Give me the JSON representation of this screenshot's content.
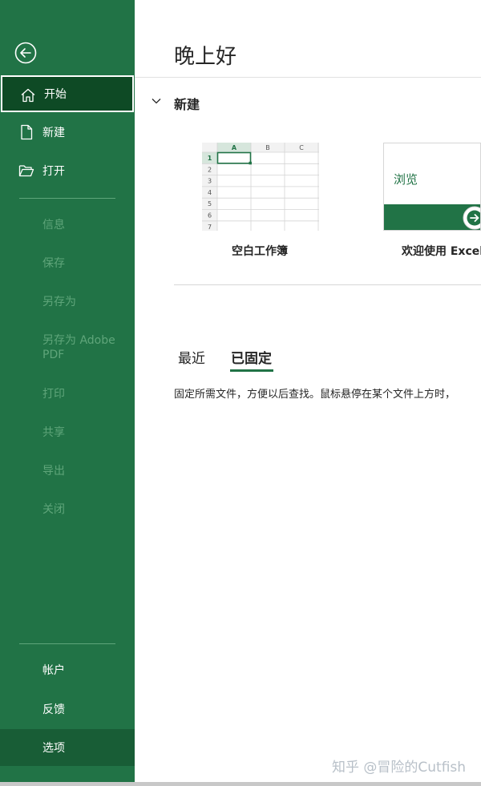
{
  "sidebar": {
    "back_icon": "back-arrow-icon",
    "items": [
      {
        "label": "开始",
        "icon": "home-icon"
      },
      {
        "label": "新建",
        "icon": "new-file-icon"
      },
      {
        "label": "打开",
        "icon": "open-folder-icon"
      }
    ],
    "disabled_items": [
      {
        "label": "信息"
      },
      {
        "label": "保存"
      },
      {
        "label": "另存为"
      },
      {
        "label": "另存为 Adobe PDF"
      },
      {
        "label": "打印"
      },
      {
        "label": "共享"
      },
      {
        "label": "导出"
      },
      {
        "label": "关闭"
      }
    ],
    "bottom_items": [
      {
        "label": "帐户"
      },
      {
        "label": "反馈"
      },
      {
        "label": "选项"
      }
    ]
  },
  "main": {
    "greeting": "晚上好",
    "new_section": {
      "title": "新建",
      "templates": [
        {
          "label": "空白工作簿",
          "thumb_columns": [
            "A",
            "B",
            "C"
          ],
          "thumb_rows": [
            "1",
            "2",
            "3",
            "4",
            "5",
            "6",
            "7"
          ]
        },
        {
          "label": "欢迎使用 Excel",
          "thumb_text": "浏览"
        }
      ]
    },
    "tabs": [
      {
        "label": "最近"
      },
      {
        "label": "已固定"
      }
    ],
    "pinned_description": "固定所需文件，方便以后查找。鼠标悬停在某个文件上方时，"
  },
  "watermark": "知乎 @冒险的Cutfish",
  "colors": {
    "brand_green": "#217346",
    "active_green": "#0e4a25",
    "disabled_text": "#5fa57a"
  }
}
